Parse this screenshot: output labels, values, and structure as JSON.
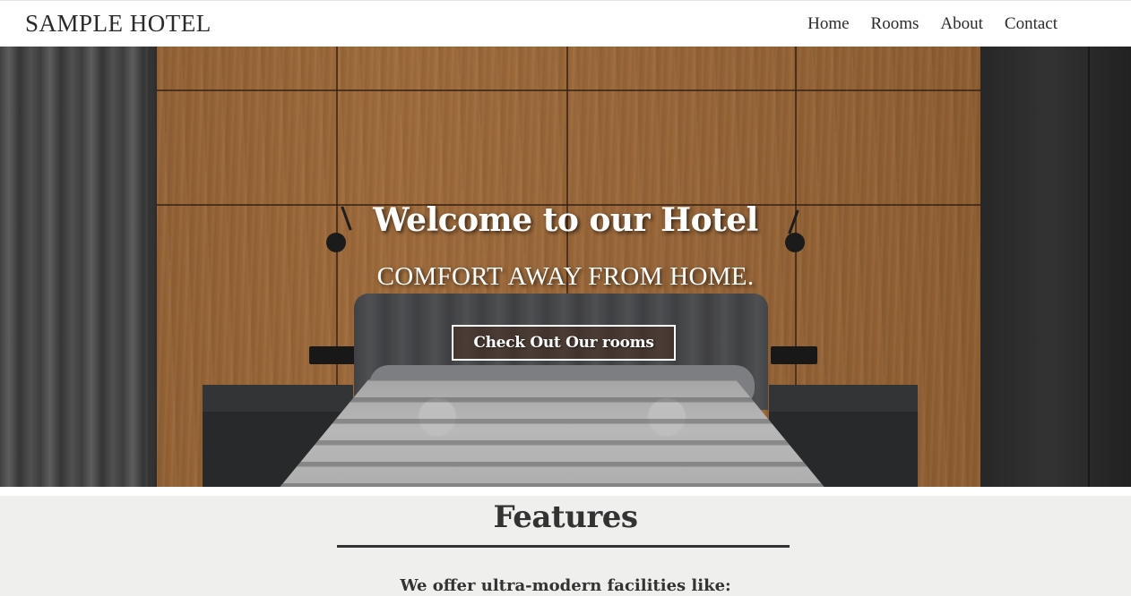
{
  "header": {
    "brand": "SAMPLE HOTEL",
    "nav": [
      {
        "label": "Home"
      },
      {
        "label": "Rooms"
      },
      {
        "label": "About"
      },
      {
        "label": "Contact"
      }
    ]
  },
  "hero": {
    "title": "Welcome to our Hotel",
    "subtitle": "COMFORT AWAY FROM HOME.",
    "cta_label": "Check Out Our rooms"
  },
  "features": {
    "heading": "Features",
    "intro": "We offer ultra-modern facilities like:"
  },
  "colors": {
    "header_bg": "#ffffff",
    "text_dark": "#2a2a2a",
    "features_bg": "#efefed",
    "hero_text": "#ffffff"
  }
}
